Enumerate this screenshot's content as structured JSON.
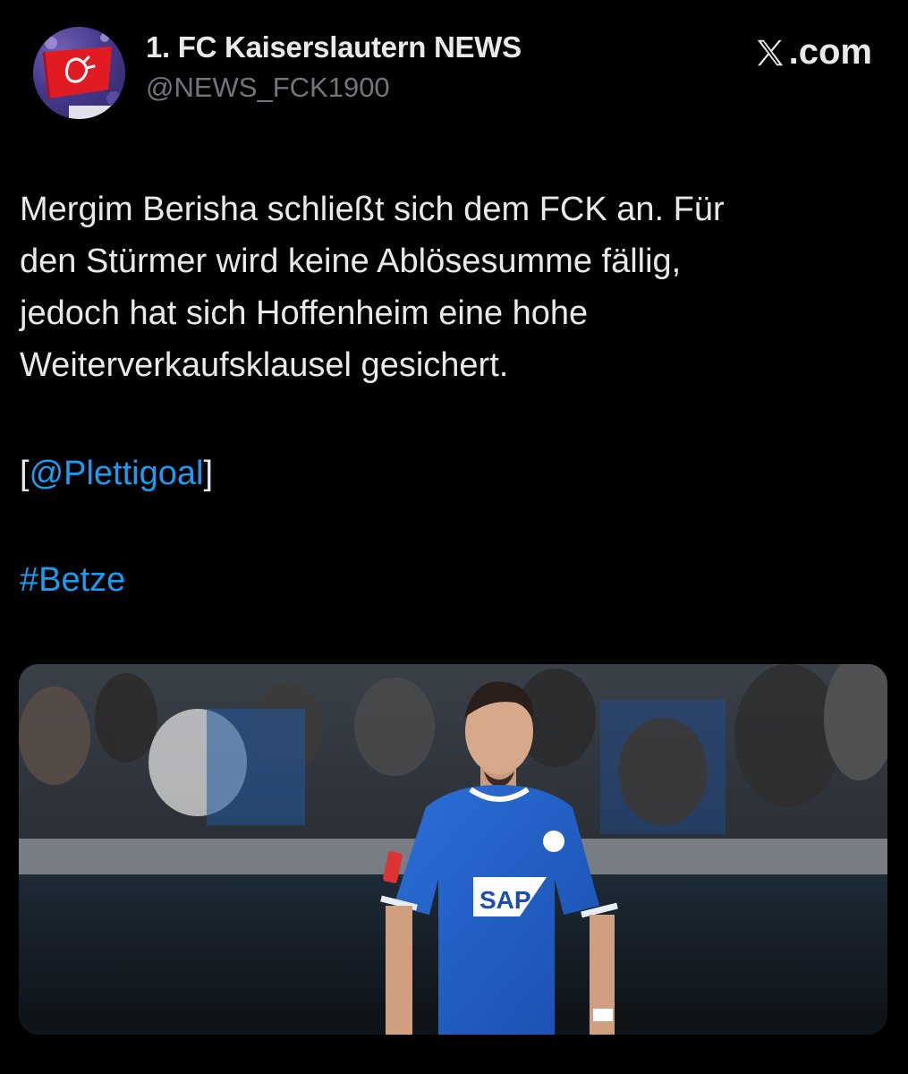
{
  "account": {
    "display_name": "1. FC Kaiserslautern NEWS",
    "handle": "@NEWS_FCK1900",
    "avatar_icon": "fck-flag-avatar"
  },
  "brand": {
    "icon": "x-logo-icon",
    "suffix": ".com"
  },
  "tweet": {
    "lines": [
      "Mergim Berisha schließt sich dem FCK an. Für",
      "den Stürmer wird keine Ablösesumme fällig,",
      "jedoch hat sich Hoffenheim eine hohe",
      "Weiterverkaufsklausel gesichert."
    ],
    "mention_open": "[",
    "mention": "@Plettigoal",
    "mention_close": "]",
    "hashtag": "#Betze"
  },
  "media": {
    "jersey_sponsor": "SAP"
  },
  "colors": {
    "background": "#000000",
    "text": "#e7e9ea",
    "secondary": "#71767b",
    "link": "#1d9bf0",
    "jersey": "#1f5fc4"
  }
}
